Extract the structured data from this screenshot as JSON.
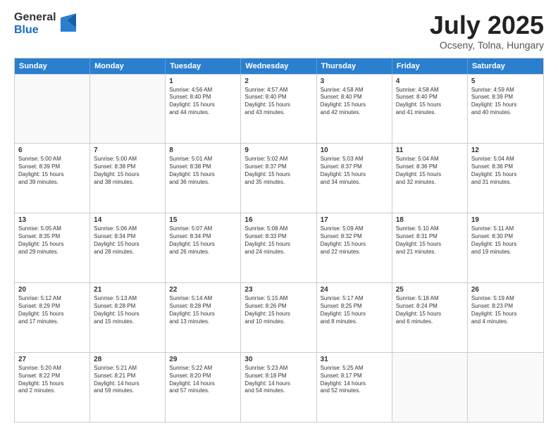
{
  "header": {
    "logo_general": "General",
    "logo_blue": "Blue",
    "month_title": "July 2025",
    "location": "Ocseny, Tolna, Hungary"
  },
  "weekdays": [
    "Sunday",
    "Monday",
    "Tuesday",
    "Wednesday",
    "Thursday",
    "Friday",
    "Saturday"
  ],
  "rows": [
    [
      {
        "day": "",
        "info": ""
      },
      {
        "day": "",
        "info": ""
      },
      {
        "day": "1",
        "info": "Sunrise: 4:56 AM\nSunset: 8:40 PM\nDaylight: 15 hours\nand 44 minutes."
      },
      {
        "day": "2",
        "info": "Sunrise: 4:57 AM\nSunset: 8:40 PM\nDaylight: 15 hours\nand 43 minutes."
      },
      {
        "day": "3",
        "info": "Sunrise: 4:58 AM\nSunset: 8:40 PM\nDaylight: 15 hours\nand 42 minutes."
      },
      {
        "day": "4",
        "info": "Sunrise: 4:58 AM\nSunset: 8:40 PM\nDaylight: 15 hours\nand 41 minutes."
      },
      {
        "day": "5",
        "info": "Sunrise: 4:59 AM\nSunset: 8:39 PM\nDaylight: 15 hours\nand 40 minutes."
      }
    ],
    [
      {
        "day": "6",
        "info": "Sunrise: 5:00 AM\nSunset: 8:39 PM\nDaylight: 15 hours\nand 39 minutes."
      },
      {
        "day": "7",
        "info": "Sunrise: 5:00 AM\nSunset: 8:38 PM\nDaylight: 15 hours\nand 38 minutes."
      },
      {
        "day": "8",
        "info": "Sunrise: 5:01 AM\nSunset: 8:38 PM\nDaylight: 15 hours\nand 36 minutes."
      },
      {
        "day": "9",
        "info": "Sunrise: 5:02 AM\nSunset: 8:37 PM\nDaylight: 15 hours\nand 35 minutes."
      },
      {
        "day": "10",
        "info": "Sunrise: 5:03 AM\nSunset: 8:37 PM\nDaylight: 15 hours\nand 34 minutes."
      },
      {
        "day": "11",
        "info": "Sunrise: 5:04 AM\nSunset: 8:36 PM\nDaylight: 15 hours\nand 32 minutes."
      },
      {
        "day": "12",
        "info": "Sunrise: 5:04 AM\nSunset: 8:36 PM\nDaylight: 15 hours\nand 31 minutes."
      }
    ],
    [
      {
        "day": "13",
        "info": "Sunrise: 5:05 AM\nSunset: 8:35 PM\nDaylight: 15 hours\nand 29 minutes."
      },
      {
        "day": "14",
        "info": "Sunrise: 5:06 AM\nSunset: 8:34 PM\nDaylight: 15 hours\nand 28 minutes."
      },
      {
        "day": "15",
        "info": "Sunrise: 5:07 AM\nSunset: 8:34 PM\nDaylight: 15 hours\nand 26 minutes."
      },
      {
        "day": "16",
        "info": "Sunrise: 5:08 AM\nSunset: 8:33 PM\nDaylight: 15 hours\nand 24 minutes."
      },
      {
        "day": "17",
        "info": "Sunrise: 5:09 AM\nSunset: 8:32 PM\nDaylight: 15 hours\nand 22 minutes."
      },
      {
        "day": "18",
        "info": "Sunrise: 5:10 AM\nSunset: 8:31 PM\nDaylight: 15 hours\nand 21 minutes."
      },
      {
        "day": "19",
        "info": "Sunrise: 5:11 AM\nSunset: 8:30 PM\nDaylight: 15 hours\nand 19 minutes."
      }
    ],
    [
      {
        "day": "20",
        "info": "Sunrise: 5:12 AM\nSunset: 8:29 PM\nDaylight: 15 hours\nand 17 minutes."
      },
      {
        "day": "21",
        "info": "Sunrise: 5:13 AM\nSunset: 8:28 PM\nDaylight: 15 hours\nand 15 minutes."
      },
      {
        "day": "22",
        "info": "Sunrise: 5:14 AM\nSunset: 8:28 PM\nDaylight: 15 hours\nand 13 minutes."
      },
      {
        "day": "23",
        "info": "Sunrise: 5:15 AM\nSunset: 8:26 PM\nDaylight: 15 hours\nand 10 minutes."
      },
      {
        "day": "24",
        "info": "Sunrise: 5:17 AM\nSunset: 8:25 PM\nDaylight: 15 hours\nand 8 minutes."
      },
      {
        "day": "25",
        "info": "Sunrise: 5:18 AM\nSunset: 8:24 PM\nDaylight: 15 hours\nand 6 minutes."
      },
      {
        "day": "26",
        "info": "Sunrise: 5:19 AM\nSunset: 8:23 PM\nDaylight: 15 hours\nand 4 minutes."
      }
    ],
    [
      {
        "day": "27",
        "info": "Sunrise: 5:20 AM\nSunset: 8:22 PM\nDaylight: 15 hours\nand 2 minutes."
      },
      {
        "day": "28",
        "info": "Sunrise: 5:21 AM\nSunset: 8:21 PM\nDaylight: 14 hours\nand 59 minutes."
      },
      {
        "day": "29",
        "info": "Sunrise: 5:22 AM\nSunset: 8:20 PM\nDaylight: 14 hours\nand 57 minutes."
      },
      {
        "day": "30",
        "info": "Sunrise: 5:23 AM\nSunset: 8:18 PM\nDaylight: 14 hours\nand 54 minutes."
      },
      {
        "day": "31",
        "info": "Sunrise: 5:25 AM\nSunset: 8:17 PM\nDaylight: 14 hours\nand 52 minutes."
      },
      {
        "day": "",
        "info": ""
      },
      {
        "day": "",
        "info": ""
      }
    ]
  ]
}
